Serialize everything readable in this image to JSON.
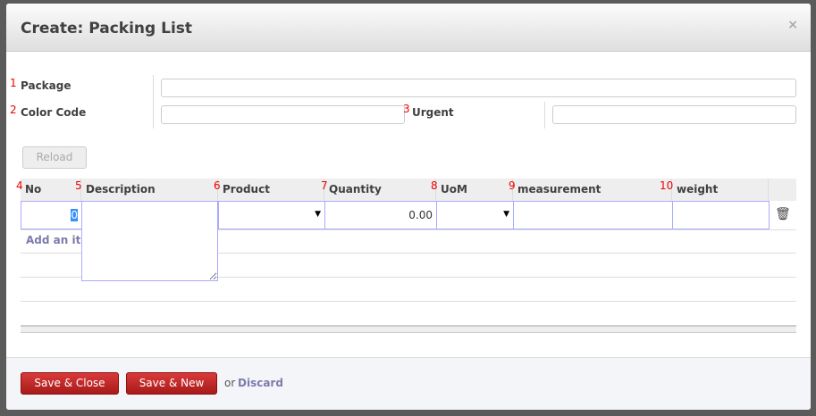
{
  "dialog": {
    "title": "Create: Packing List",
    "close": "×"
  },
  "form": {
    "package": {
      "num": "1",
      "label": "Package",
      "value": ""
    },
    "color_code": {
      "num": "2",
      "label": "Color Code",
      "value": ""
    },
    "urgent": {
      "num": "3",
      "label": "Urgent",
      "value": ""
    },
    "reload": "Reload"
  },
  "table": {
    "columns": [
      {
        "num": "4",
        "label": "No"
      },
      {
        "num": "5",
        "label": "Description"
      },
      {
        "num": "6",
        "label": "Product"
      },
      {
        "num": "7",
        "label": "Quantity"
      },
      {
        "num": "8",
        "label": "UoM"
      },
      {
        "num": "9",
        "label": "measurement"
      },
      {
        "num": "10",
        "label": "weight"
      }
    ],
    "row": {
      "no": "0",
      "quantity": "0.00"
    },
    "add_item": "Add an item"
  },
  "footer": {
    "save_close": "Save & Close",
    "save_new": "Save & New",
    "or": "or",
    "discard": "Discard"
  }
}
